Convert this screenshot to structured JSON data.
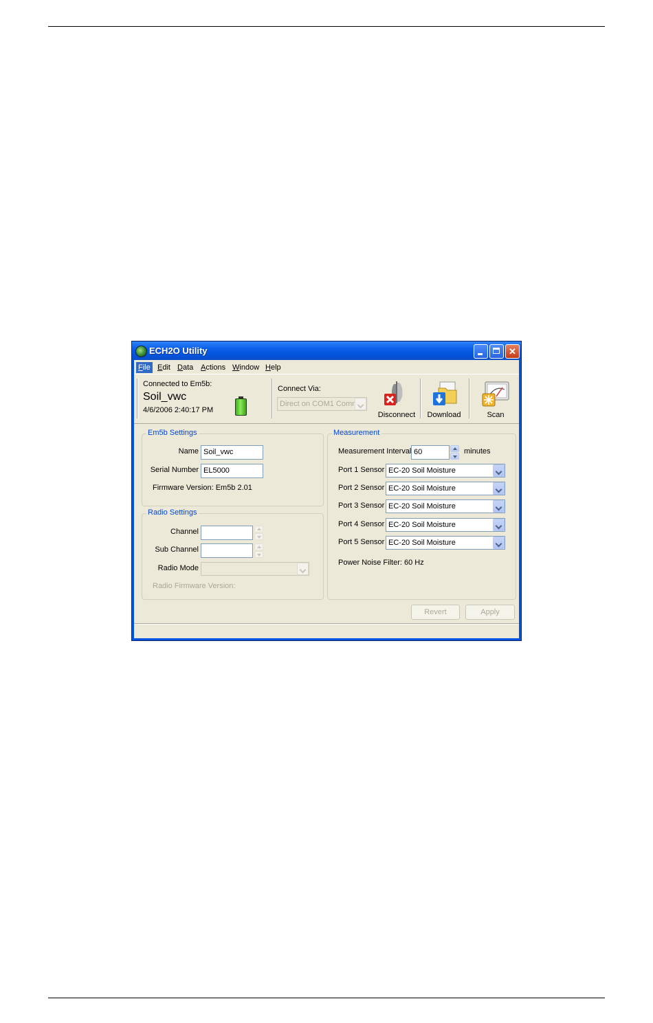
{
  "window": {
    "title": "ECH2O Utility"
  },
  "menu": [
    {
      "label": "File",
      "key": "F",
      "rest": "ile"
    },
    {
      "label": "Edit",
      "key": "E",
      "rest": "dit"
    },
    {
      "label": "Data",
      "key": "D",
      "rest": "ata"
    },
    {
      "label": "Actions",
      "key": "A",
      "rest": "ctions"
    },
    {
      "label": "Window",
      "key": "W",
      "rest": "indow"
    },
    {
      "label": "Help",
      "key": "H",
      "rest": "elp"
    }
  ],
  "connection": {
    "connected_label": "Connected to Em5b:",
    "device_name": "Soil_vwc",
    "timestamp": "4/6/2006 2:40:17 PM",
    "connect_via_label": "Connect Via:",
    "connect_via_value": "Direct on COM1 Comm"
  },
  "toolbar": {
    "disconnect": "Disconnect",
    "download": "Download",
    "scan": "Scan"
  },
  "em5b_settings": {
    "title": "Em5b Settings",
    "name_label": "Name",
    "name_value": "Soil_vwc",
    "serial_label": "Serial Number",
    "serial_value": "EL5000",
    "firmware_text": "Firmware Version: Em5b 2.01"
  },
  "radio_settings": {
    "title": "Radio Settings",
    "channel_label": "Channel",
    "subchannel_label": "Sub Channel",
    "mode_label": "Radio Mode",
    "firmware_text": "Radio Firmware Version:"
  },
  "measurement": {
    "title": "Measurement",
    "interval_label": "Measurement Interval",
    "interval_value": "60",
    "interval_unit": "minutes",
    "ports": [
      {
        "label": "Port 1 Sensor",
        "value": "EC-20 Soil Moisture"
      },
      {
        "label": "Port 2 Sensor",
        "value": "EC-20 Soil Moisture"
      },
      {
        "label": "Port 3 Sensor",
        "value": "EC-20 Soil Moisture"
      },
      {
        "label": "Port 4 Sensor",
        "value": "EC-20 Soil Moisture"
      },
      {
        "label": "Port 5 Sensor",
        "value": "EC-20 Soil Moisture"
      }
    ],
    "noise_filter": "Power Noise Filter: 60 Hz"
  },
  "buttons": {
    "revert": "Revert",
    "apply": "Apply"
  },
  "colors": {
    "titlebar": "#0054e3",
    "client": "#ece9d8",
    "group_title": "#0046d5",
    "menu_active": "#316ac5"
  },
  "icons": [
    "app-icon",
    "minimize-icon",
    "maximize-icon",
    "close-icon",
    "battery-icon",
    "disconnect-icon",
    "download-icon",
    "scan-icon"
  ]
}
